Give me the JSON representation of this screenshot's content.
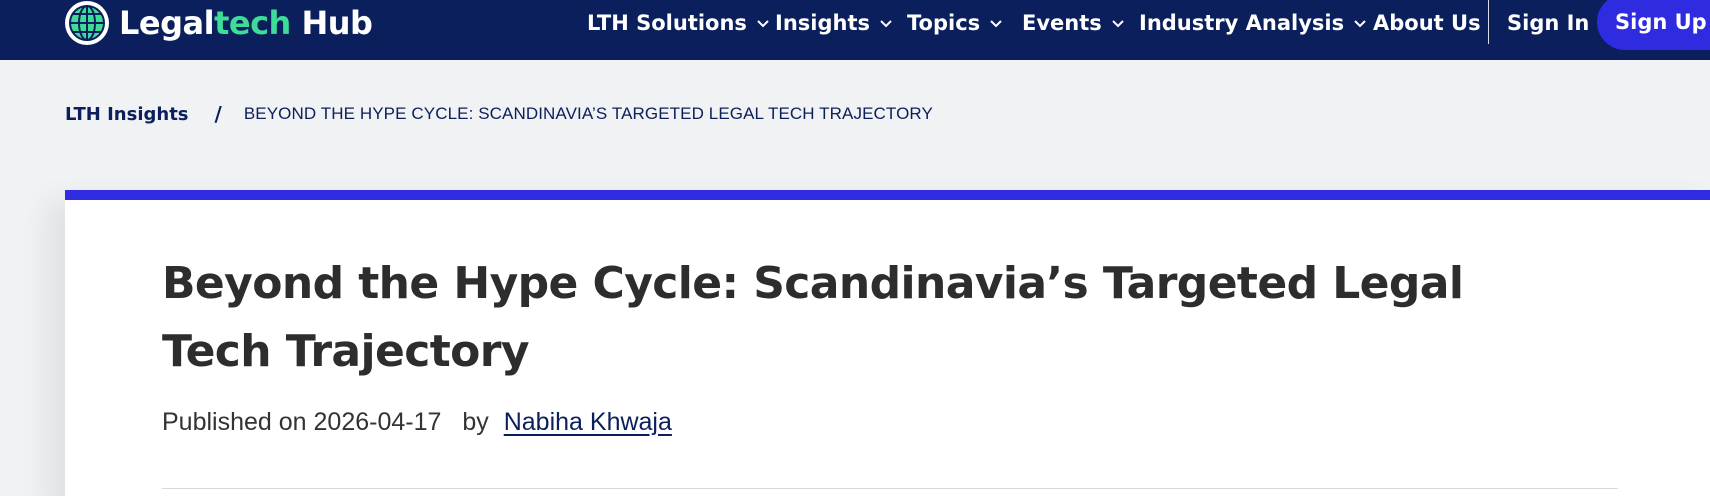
{
  "header": {
    "logo": {
      "part1": "Legal",
      "part2": "tech",
      "part3": " Hub",
      "icon": "globe-icon"
    },
    "nav": [
      {
        "label": "LTH Solutions",
        "dropdown": true
      },
      {
        "label": "Insights",
        "dropdown": true
      },
      {
        "label": "Topics",
        "dropdown": true
      },
      {
        "label": "Events",
        "dropdown": true
      },
      {
        "label": "Industry Analysis",
        "dropdown": true
      },
      {
        "label": "About Us",
        "dropdown": false
      }
    ],
    "sign_in": "Sign In",
    "sign_up": "Sign Up"
  },
  "breadcrumb": {
    "parent": "LTH Insights",
    "separator": "/",
    "current": "BEYOND THE HYPE CYCLE: SCANDINAVIA’S TARGETED LEGAL TECH TRAJECTORY"
  },
  "article": {
    "title": "Beyond the Hype Cycle: Scandinavia’s Targeted Legal Tech Trajectory",
    "published_prefix": "Published on",
    "date": "2026-04-17",
    "by": "by",
    "author": "Nabiha Khwaja"
  },
  "colors": {
    "nav_background": "#0b1f5c",
    "accent_green": "#3ddc97",
    "brand_blue": "#2f2be0",
    "page_background": "#f1f2f4"
  }
}
